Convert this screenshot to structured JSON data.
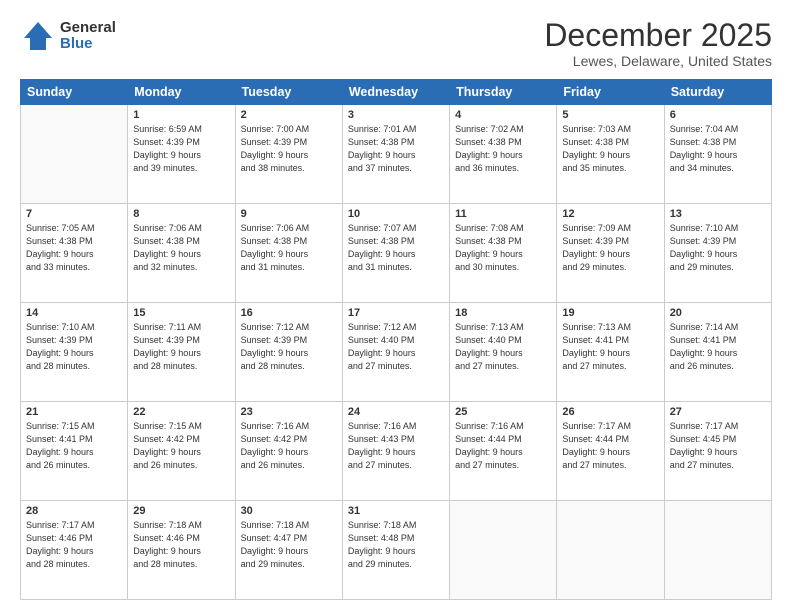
{
  "logo": {
    "general": "General",
    "blue": "Blue"
  },
  "header": {
    "title": "December 2025",
    "location": "Lewes, Delaware, United States"
  },
  "weekdays": [
    "Sunday",
    "Monday",
    "Tuesday",
    "Wednesday",
    "Thursday",
    "Friday",
    "Saturday"
  ],
  "weeks": [
    [
      {
        "day": "",
        "sunrise": "",
        "sunset": "",
        "daylight": ""
      },
      {
        "day": "1",
        "sunrise": "Sunrise: 6:59 AM",
        "sunset": "Sunset: 4:39 PM",
        "daylight": "Daylight: 9 hours and 39 minutes."
      },
      {
        "day": "2",
        "sunrise": "Sunrise: 7:00 AM",
        "sunset": "Sunset: 4:39 PM",
        "daylight": "Daylight: 9 hours and 38 minutes."
      },
      {
        "day": "3",
        "sunrise": "Sunrise: 7:01 AM",
        "sunset": "Sunset: 4:38 PM",
        "daylight": "Daylight: 9 hours and 37 minutes."
      },
      {
        "day": "4",
        "sunrise": "Sunrise: 7:02 AM",
        "sunset": "Sunset: 4:38 PM",
        "daylight": "Daylight: 9 hours and 36 minutes."
      },
      {
        "day": "5",
        "sunrise": "Sunrise: 7:03 AM",
        "sunset": "Sunset: 4:38 PM",
        "daylight": "Daylight: 9 hours and 35 minutes."
      },
      {
        "day": "6",
        "sunrise": "Sunrise: 7:04 AM",
        "sunset": "Sunset: 4:38 PM",
        "daylight": "Daylight: 9 hours and 34 minutes."
      }
    ],
    [
      {
        "day": "7",
        "sunrise": "Sunrise: 7:05 AM",
        "sunset": "Sunset: 4:38 PM",
        "daylight": "Daylight: 9 hours and 33 minutes."
      },
      {
        "day": "8",
        "sunrise": "Sunrise: 7:06 AM",
        "sunset": "Sunset: 4:38 PM",
        "daylight": "Daylight: 9 hours and 32 minutes."
      },
      {
        "day": "9",
        "sunrise": "Sunrise: 7:06 AM",
        "sunset": "Sunset: 4:38 PM",
        "daylight": "Daylight: 9 hours and 31 minutes."
      },
      {
        "day": "10",
        "sunrise": "Sunrise: 7:07 AM",
        "sunset": "Sunset: 4:38 PM",
        "daylight": "Daylight: 9 hours and 31 minutes."
      },
      {
        "day": "11",
        "sunrise": "Sunrise: 7:08 AM",
        "sunset": "Sunset: 4:38 PM",
        "daylight": "Daylight: 9 hours and 30 minutes."
      },
      {
        "day": "12",
        "sunrise": "Sunrise: 7:09 AM",
        "sunset": "Sunset: 4:39 PM",
        "daylight": "Daylight: 9 hours and 29 minutes."
      },
      {
        "day": "13",
        "sunrise": "Sunrise: 7:10 AM",
        "sunset": "Sunset: 4:39 PM",
        "daylight": "Daylight: 9 hours and 29 minutes."
      }
    ],
    [
      {
        "day": "14",
        "sunrise": "Sunrise: 7:10 AM",
        "sunset": "Sunset: 4:39 PM",
        "daylight": "Daylight: 9 hours and 28 minutes."
      },
      {
        "day": "15",
        "sunrise": "Sunrise: 7:11 AM",
        "sunset": "Sunset: 4:39 PM",
        "daylight": "Daylight: 9 hours and 28 minutes."
      },
      {
        "day": "16",
        "sunrise": "Sunrise: 7:12 AM",
        "sunset": "Sunset: 4:39 PM",
        "daylight": "Daylight: 9 hours and 28 minutes."
      },
      {
        "day": "17",
        "sunrise": "Sunrise: 7:12 AM",
        "sunset": "Sunset: 4:40 PM",
        "daylight": "Daylight: 9 hours and 27 minutes."
      },
      {
        "day": "18",
        "sunrise": "Sunrise: 7:13 AM",
        "sunset": "Sunset: 4:40 PM",
        "daylight": "Daylight: 9 hours and 27 minutes."
      },
      {
        "day": "19",
        "sunrise": "Sunrise: 7:13 AM",
        "sunset": "Sunset: 4:41 PM",
        "daylight": "Daylight: 9 hours and 27 minutes."
      },
      {
        "day": "20",
        "sunrise": "Sunrise: 7:14 AM",
        "sunset": "Sunset: 4:41 PM",
        "daylight": "Daylight: 9 hours and 26 minutes."
      }
    ],
    [
      {
        "day": "21",
        "sunrise": "Sunrise: 7:15 AM",
        "sunset": "Sunset: 4:41 PM",
        "daylight": "Daylight: 9 hours and 26 minutes."
      },
      {
        "day": "22",
        "sunrise": "Sunrise: 7:15 AM",
        "sunset": "Sunset: 4:42 PM",
        "daylight": "Daylight: 9 hours and 26 minutes."
      },
      {
        "day": "23",
        "sunrise": "Sunrise: 7:16 AM",
        "sunset": "Sunset: 4:42 PM",
        "daylight": "Daylight: 9 hours and 26 minutes."
      },
      {
        "day": "24",
        "sunrise": "Sunrise: 7:16 AM",
        "sunset": "Sunset: 4:43 PM",
        "daylight": "Daylight: 9 hours and 27 minutes."
      },
      {
        "day": "25",
        "sunrise": "Sunrise: 7:16 AM",
        "sunset": "Sunset: 4:44 PM",
        "daylight": "Daylight: 9 hours and 27 minutes."
      },
      {
        "day": "26",
        "sunrise": "Sunrise: 7:17 AM",
        "sunset": "Sunset: 4:44 PM",
        "daylight": "Daylight: 9 hours and 27 minutes."
      },
      {
        "day": "27",
        "sunrise": "Sunrise: 7:17 AM",
        "sunset": "Sunset: 4:45 PM",
        "daylight": "Daylight: 9 hours and 27 minutes."
      }
    ],
    [
      {
        "day": "28",
        "sunrise": "Sunrise: 7:17 AM",
        "sunset": "Sunset: 4:46 PM",
        "daylight": "Daylight: 9 hours and 28 minutes."
      },
      {
        "day": "29",
        "sunrise": "Sunrise: 7:18 AM",
        "sunset": "Sunset: 4:46 PM",
        "daylight": "Daylight: 9 hours and 28 minutes."
      },
      {
        "day": "30",
        "sunrise": "Sunrise: 7:18 AM",
        "sunset": "Sunset: 4:47 PM",
        "daylight": "Daylight: 9 hours and 29 minutes."
      },
      {
        "day": "31",
        "sunrise": "Sunrise: 7:18 AM",
        "sunset": "Sunset: 4:48 PM",
        "daylight": "Daylight: 9 hours and 29 minutes."
      },
      {
        "day": "",
        "sunrise": "",
        "sunset": "",
        "daylight": ""
      },
      {
        "day": "",
        "sunrise": "",
        "sunset": "",
        "daylight": ""
      },
      {
        "day": "",
        "sunrise": "",
        "sunset": "",
        "daylight": ""
      }
    ]
  ]
}
